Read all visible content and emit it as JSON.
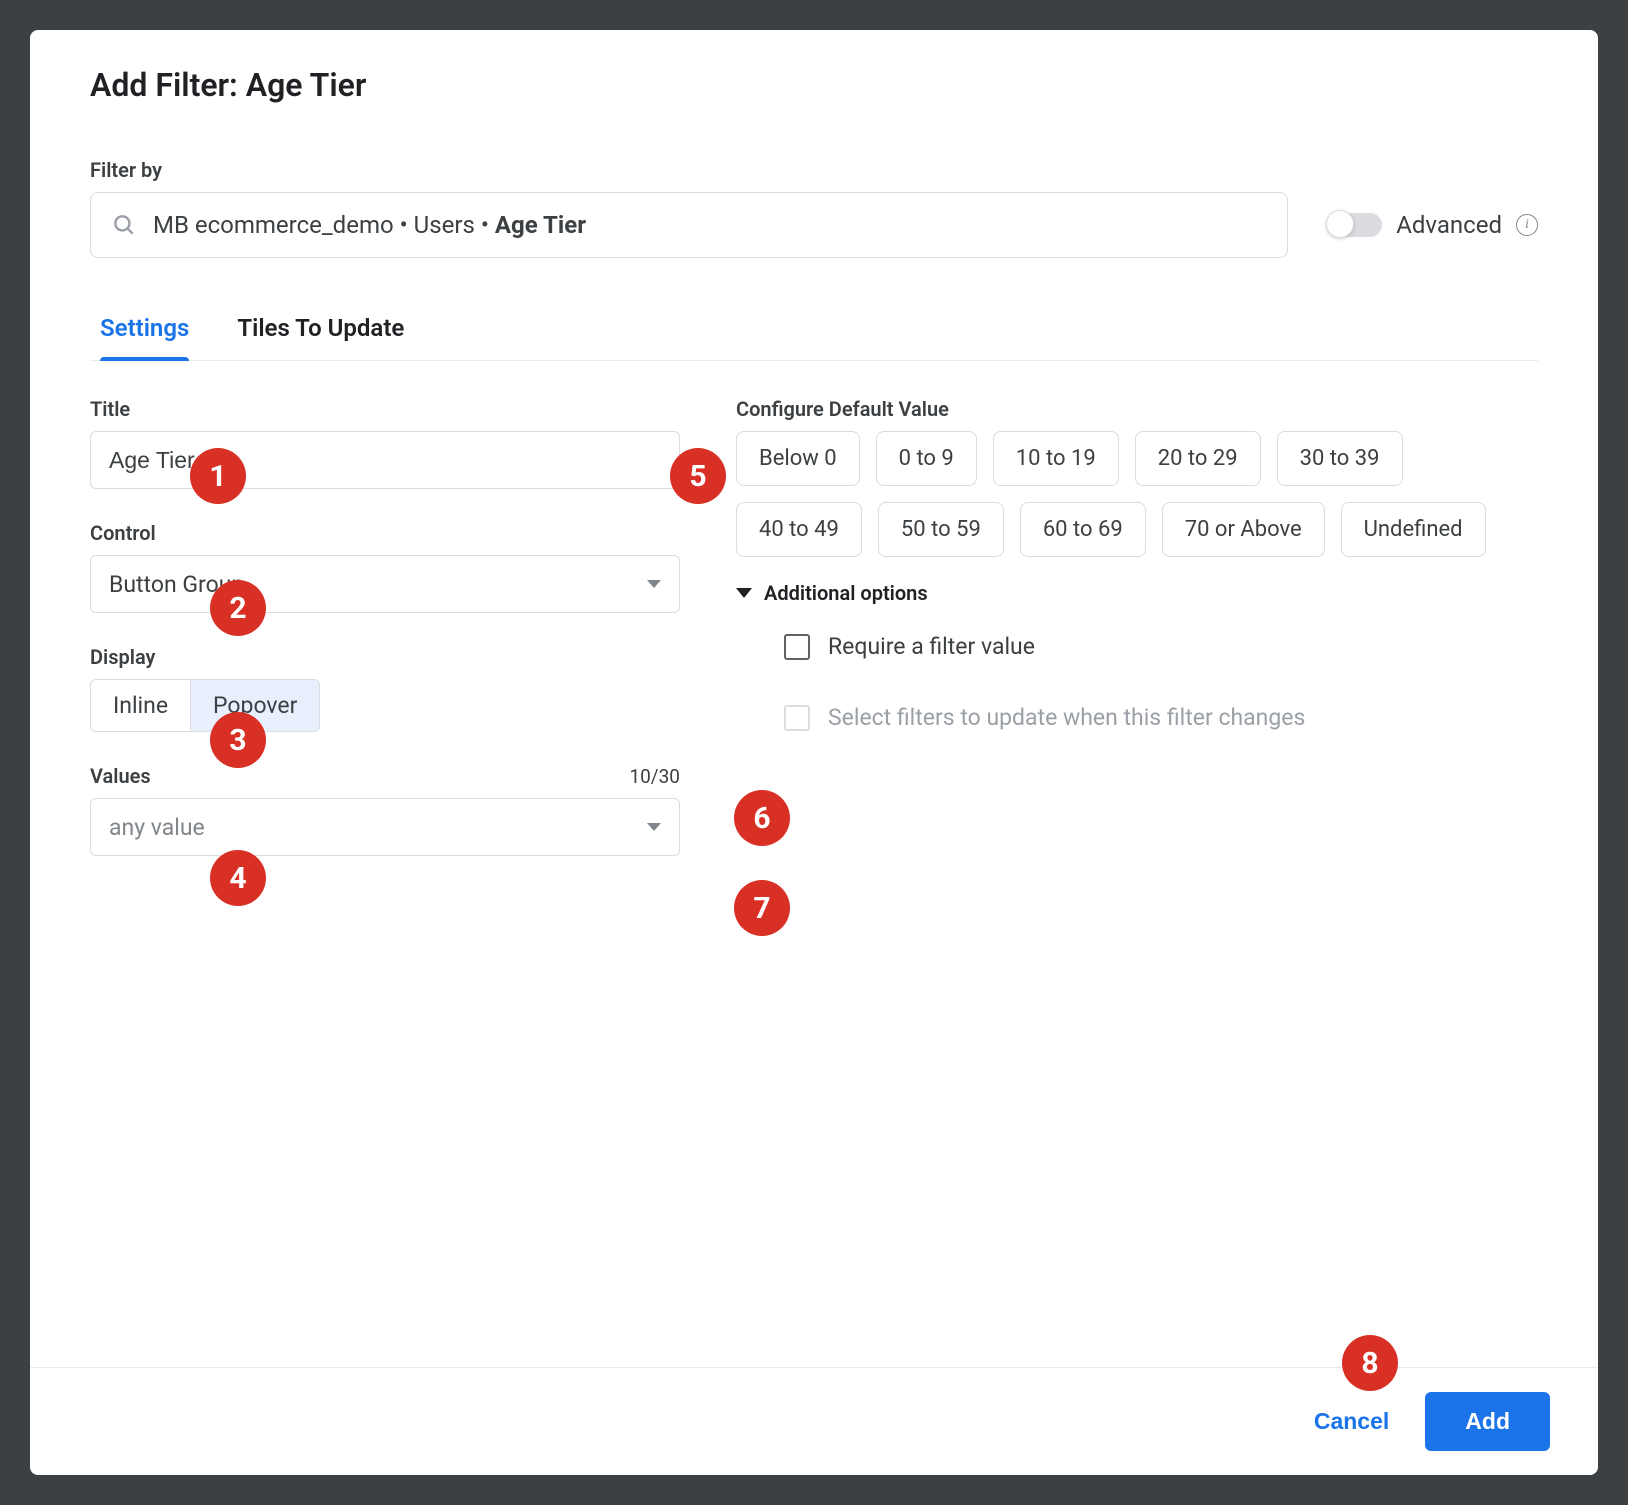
{
  "dialog_title": "Add Filter: Age Tier",
  "filter_by": {
    "label": "Filter by",
    "path_prefix": "MB ecommerce_demo • Users • ",
    "path_bold": "Age Tier"
  },
  "advanced": {
    "label": "Advanced",
    "enabled": false
  },
  "tabs": {
    "settings": "Settings",
    "tiles": "Tiles To Update",
    "active": "settings"
  },
  "settings": {
    "title_label": "Title",
    "title_value": "Age Tier",
    "control_label": "Control",
    "control_value": "Button Group",
    "display_label": "Display",
    "display_options": [
      "Inline",
      "Popover"
    ],
    "display_selected": "Popover",
    "values_label": "Values",
    "values_count": "10/30",
    "values_value": "any value",
    "configure_label": "Configure Default Value",
    "default_values": [
      "Below 0",
      "0 to 9",
      "10 to 19",
      "20 to 29",
      "30 to 39",
      "40 to 49",
      "50 to 59",
      "60 to 69",
      "70 or Above",
      "Undefined"
    ],
    "additional_label": "Additional options",
    "require_label": "Require a filter value",
    "update_filters_label": "Select filters to update when this filter changes"
  },
  "footer": {
    "cancel": "Cancel",
    "add": "Add"
  },
  "callouts": [
    "1",
    "2",
    "3",
    "4",
    "5",
    "6",
    "7",
    "8"
  ]
}
